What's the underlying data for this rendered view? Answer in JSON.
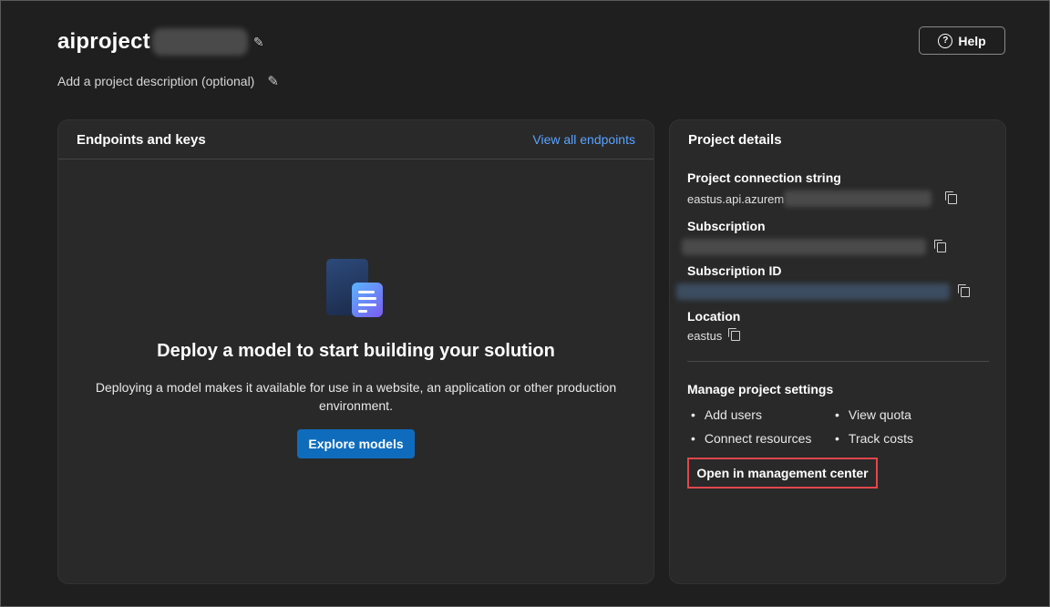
{
  "header": {
    "title": "aiproject",
    "description_prompt": "Add a project description (optional)",
    "help_label": "Help"
  },
  "endpoints": {
    "title": "Endpoints and keys",
    "view_all": "View all endpoints",
    "empty_title": "Deploy a model to start building your solution",
    "empty_sub": "Deploying a model makes it available for use in a website, an application or other production environment.",
    "explore_label": "Explore models"
  },
  "details": {
    "title": "Project details",
    "connection_label": "Project connection string",
    "connection_value": "eastus.api.azurem",
    "subscription_label": "Subscription",
    "subscription_id_label": "Subscription ID",
    "location_label": "Location",
    "location_value": "eastus",
    "manage_label": "Manage project settings",
    "settings_links": [
      "Add users",
      "View quota",
      "Connect resources",
      "Track costs"
    ],
    "open_mgmt_label": "Open in management center"
  },
  "colors": {
    "accent": "#0f6cbd",
    "link": "#5aa3ff",
    "highlight": "#e0474c"
  }
}
